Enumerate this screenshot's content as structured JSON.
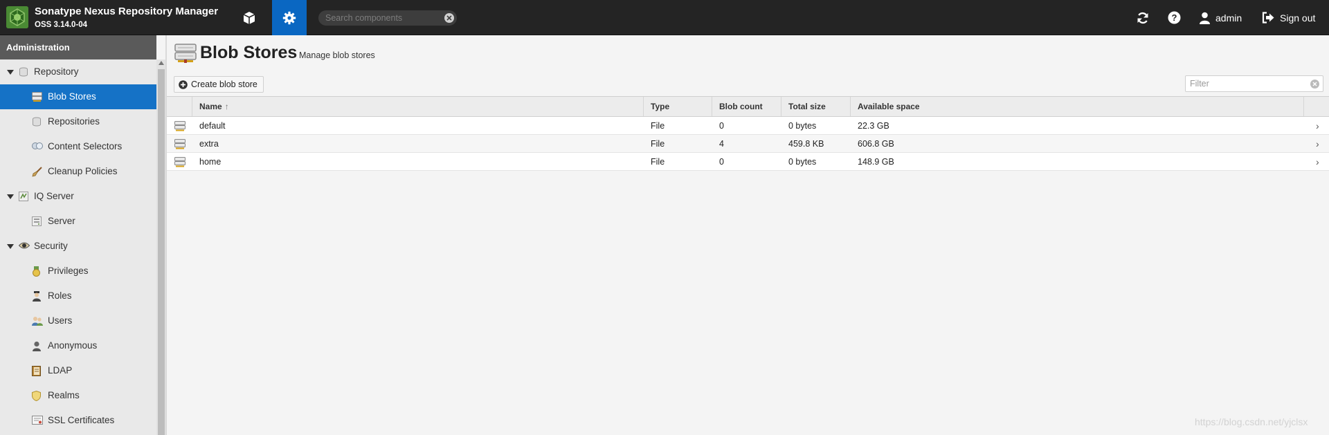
{
  "header": {
    "app_title": "Sonatype Nexus Repository Manager",
    "version": "OSS 3.14.0-04",
    "search_placeholder": "Search components",
    "username": "admin",
    "sign_out_label": "Sign out"
  },
  "sidebar": {
    "title": "Administration",
    "items": [
      {
        "label": "Repository",
        "level": 1,
        "icon": "database-icon"
      },
      {
        "label": "Blob Stores",
        "level": 2,
        "icon": "blob-store-icon",
        "selected": true
      },
      {
        "label": "Repositories",
        "level": 2,
        "icon": "database-icon"
      },
      {
        "label": "Content Selectors",
        "level": 2,
        "icon": "content-selector-icon"
      },
      {
        "label": "Cleanup Policies",
        "level": 2,
        "icon": "broom-icon"
      },
      {
        "label": "IQ Server",
        "level": 1,
        "icon": "iq-server-icon"
      },
      {
        "label": "Server",
        "level": 2,
        "icon": "server-icon"
      },
      {
        "label": "Security",
        "level": 1,
        "icon": "eye-icon"
      },
      {
        "label": "Privileges",
        "level": 2,
        "icon": "medal-icon"
      },
      {
        "label": "Roles",
        "level": 2,
        "icon": "role-icon"
      },
      {
        "label": "Users",
        "level": 2,
        "icon": "users-icon"
      },
      {
        "label": "Anonymous",
        "level": 2,
        "icon": "anonymous-icon"
      },
      {
        "label": "LDAP",
        "level": 2,
        "icon": "ldap-book-icon"
      },
      {
        "label": "Realms",
        "level": 2,
        "icon": "shield-icon"
      },
      {
        "label": "SSL Certificates",
        "level": 2,
        "icon": "certificate-icon"
      }
    ]
  },
  "main": {
    "title": "Blob Stores",
    "subtitle": "Manage blob stores",
    "create_label": "Create blob store",
    "filter_placeholder": "Filter",
    "columns": [
      "Name",
      "Type",
      "Blob count",
      "Total size",
      "Available space"
    ],
    "sort_indicator": "↑",
    "rows": [
      {
        "name": "default",
        "type": "File",
        "blob_count": "0",
        "total_size": "0 bytes",
        "available_space": "22.3 GB"
      },
      {
        "name": "extra",
        "type": "File",
        "blob_count": "4",
        "total_size": "459.8 KB",
        "available_space": "606.8 GB"
      },
      {
        "name": "home",
        "type": "File",
        "blob_count": "0",
        "total_size": "0 bytes",
        "available_space": "148.9 GB"
      }
    ],
    "row_chevron": "›"
  },
  "watermark": "https://blog.csdn.net/yjclsx"
}
